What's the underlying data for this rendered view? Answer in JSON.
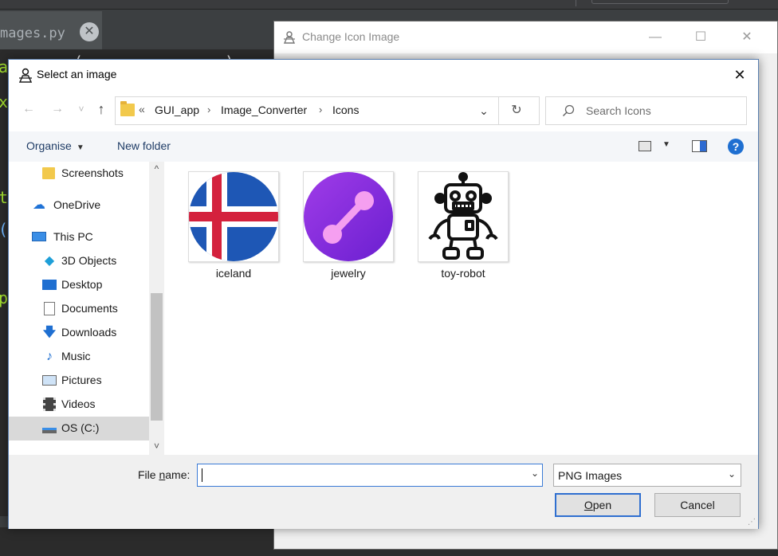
{
  "background_editor": {
    "tab_label": "mages.py",
    "code_fragments": [
      "a",
      "(",
      "x",
      "t",
      "(",
      "p",
      ")"
    ],
    "accent": "#a4e22f"
  },
  "parent_window": {
    "title": "Change Icon Image",
    "controls": {
      "minimize": "—",
      "maximize": "☐",
      "close": "✕"
    }
  },
  "dialog": {
    "title": "Select an image",
    "close": "✕"
  },
  "nav": {
    "back": "←",
    "forward": "→",
    "recent": "˅",
    "up": "↑",
    "chevrons": "«",
    "breadcrumbs": [
      "GUI_app",
      "Image_Converter",
      "Icons"
    ],
    "separator": "›",
    "dropdown": "⌄",
    "refresh": "↻",
    "search_placeholder": "Search Icons"
  },
  "toolbar": {
    "organise": "Organise",
    "new_folder": "New folder",
    "help": "?"
  },
  "sidebar": {
    "items": [
      {
        "label": "Screenshots",
        "icon": "folder-icon",
        "selected": false
      },
      {
        "label": "OneDrive",
        "icon": "cloud-icon",
        "selected": false
      },
      {
        "label": "This PC",
        "icon": "pc-icon",
        "selected": false
      },
      {
        "label": "3D Objects",
        "icon": "cube-icon",
        "selected": false
      },
      {
        "label": "Desktop",
        "icon": "desktop-icon",
        "selected": false
      },
      {
        "label": "Documents",
        "icon": "document-icon",
        "selected": false
      },
      {
        "label": "Downloads",
        "icon": "download-icon",
        "selected": false
      },
      {
        "label": "Music",
        "icon": "music-icon",
        "selected": false
      },
      {
        "label": "Pictures",
        "icon": "pictures-icon",
        "selected": false
      },
      {
        "label": "Videos",
        "icon": "video-icon",
        "selected": false
      },
      {
        "label": "OS (C:)",
        "icon": "drive-icon",
        "selected": true
      }
    ],
    "scroll_up": "^",
    "scroll_down": "˅"
  },
  "files": [
    {
      "name": "iceland",
      "icon": "iceland-flag-icon"
    },
    {
      "name": "jewelry",
      "icon": "dumbbell-icon"
    },
    {
      "name": "toy-robot",
      "icon": "robot-icon"
    }
  ],
  "bottom": {
    "file_name_label_pre": "File ",
    "file_name_label_ul": "n",
    "file_name_label_post": "ame:",
    "file_name_value": "",
    "filter": "PNG Images",
    "open_ul": "O",
    "open_rest": "pen",
    "cancel": "Cancel",
    "caret": "⌄"
  },
  "colors": {
    "accent_blue": "#2f6fd0",
    "selection_gray": "#d9d9d9",
    "folder_yellow": "#f2c94c"
  }
}
